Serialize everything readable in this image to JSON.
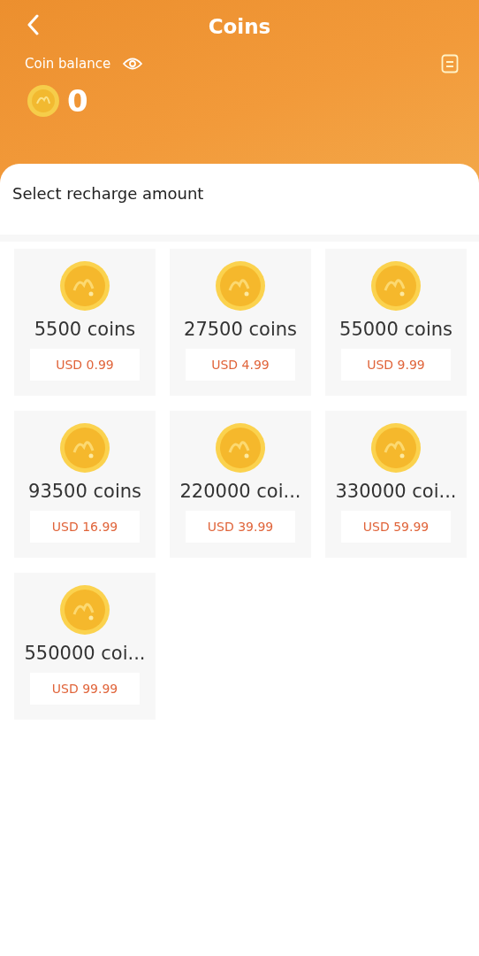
{
  "header": {
    "title": "Coins"
  },
  "balance": {
    "label": "Coin balance",
    "amount": "0"
  },
  "section": {
    "title": "Select recharge amount"
  },
  "packages": [
    {
      "coins": "5500 coins",
      "price": "USD 0.99"
    },
    {
      "coins": "27500 coins",
      "price": "USD 4.99"
    },
    {
      "coins": "55000 coins",
      "price": "USD 9.99"
    },
    {
      "coins": "93500 coins",
      "price": "USD 16.99"
    },
    {
      "coins": "220000 coi...",
      "price": "USD 39.99"
    },
    {
      "coins": "330000 coi...",
      "price": "USD 59.99"
    },
    {
      "coins": "550000 coi...",
      "price": "USD 99.99"
    }
  ]
}
